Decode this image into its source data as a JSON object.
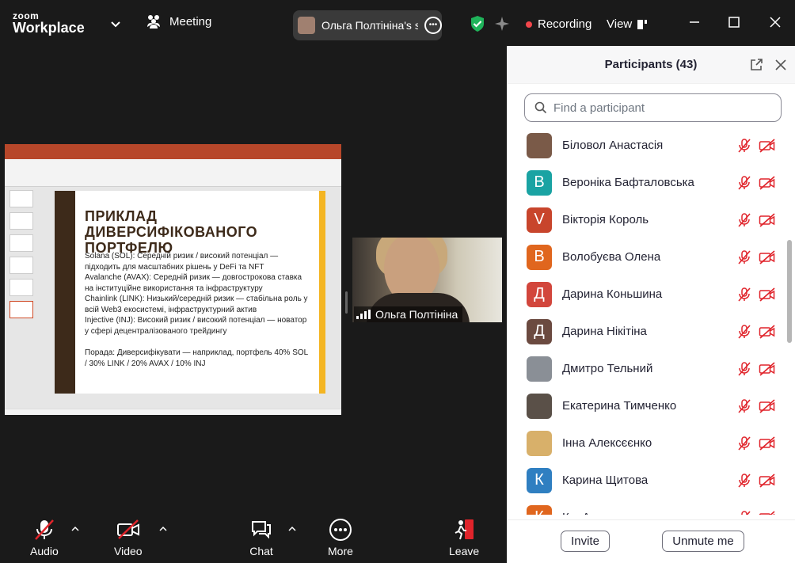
{
  "titlebar": {
    "logo_top": "zoom",
    "logo_bottom": "Workplace",
    "meeting_label": "Meeting",
    "share_label": "Ольга Полтініна's sc",
    "recording_label": "Recording",
    "view_label": "View"
  },
  "slide": {
    "title": "ПРИКЛАД ДИВЕРСИФІКОВАНОГО ПОРТФЕЛЮ",
    "lines": [
      "Solana (SOL): Середній ризик / високий потенціал — підходить для масштабних рішень у DeFi та NFT",
      "Avalanche (AVAX): Середній ризик — довгострокова ставка на інституційне використання та інфраструктуру",
      "Chainlink (LINK): Низький/середній ризик — стабільна роль у всій Web3 екосистемі, інфраструктурний актив",
      "Injective (INJ): Високий ризик / високий потенціал — новатор у сфері децентралізованого трейдингу"
    ],
    "tip": "Порада: Диверсифікувати — наприклад, портфель 40% SOL / 30% LINK / 20% AVAX / 10% INJ"
  },
  "video": {
    "name": "Ольга Полтініна"
  },
  "toolbar": {
    "audio": "Audio",
    "video": "Video",
    "chat": "Chat",
    "more": "More",
    "leave": "Leave"
  },
  "panel": {
    "title": "Participants (43)",
    "search_placeholder": "Find a participant",
    "invite": "Invite",
    "unmute": "Unmute me",
    "participants": [
      {
        "name": "Біловол Анастасія",
        "initial": "",
        "color": "#7a5a48"
      },
      {
        "name": "Вероніка Бафталовська",
        "initial": "B",
        "color": "#1aa3a3"
      },
      {
        "name": "Вікторія Король",
        "initial": "V",
        "color": "#c8452c"
      },
      {
        "name": "Волобуєва Олена",
        "initial": "В",
        "color": "#e0661e"
      },
      {
        "name": "Дарина Коньшина",
        "initial": "Д",
        "color": "#d2463c"
      },
      {
        "name": "Дарина Нікітіна",
        "initial": "Д",
        "color": "#6b4a40"
      },
      {
        "name": "Дмитро Тельний",
        "initial": "",
        "color": "#8a8f96"
      },
      {
        "name": "Екатерина Тимченко",
        "initial": "",
        "color": "#5a5048"
      },
      {
        "name": "Інна Алексєєнко",
        "initial": "",
        "color": "#d8b06a"
      },
      {
        "name": "Карина Щитова",
        "initial": "К",
        "color": "#2f7fc1"
      },
      {
        "name": "К... А...",
        "initial": "К",
        "color": "#e0661e"
      }
    ]
  },
  "colors": {
    "muted_red": "#e0242b",
    "record_red": "#f2464b",
    "shield_green": "#1fb35a",
    "leave_red": "#e0242b"
  }
}
